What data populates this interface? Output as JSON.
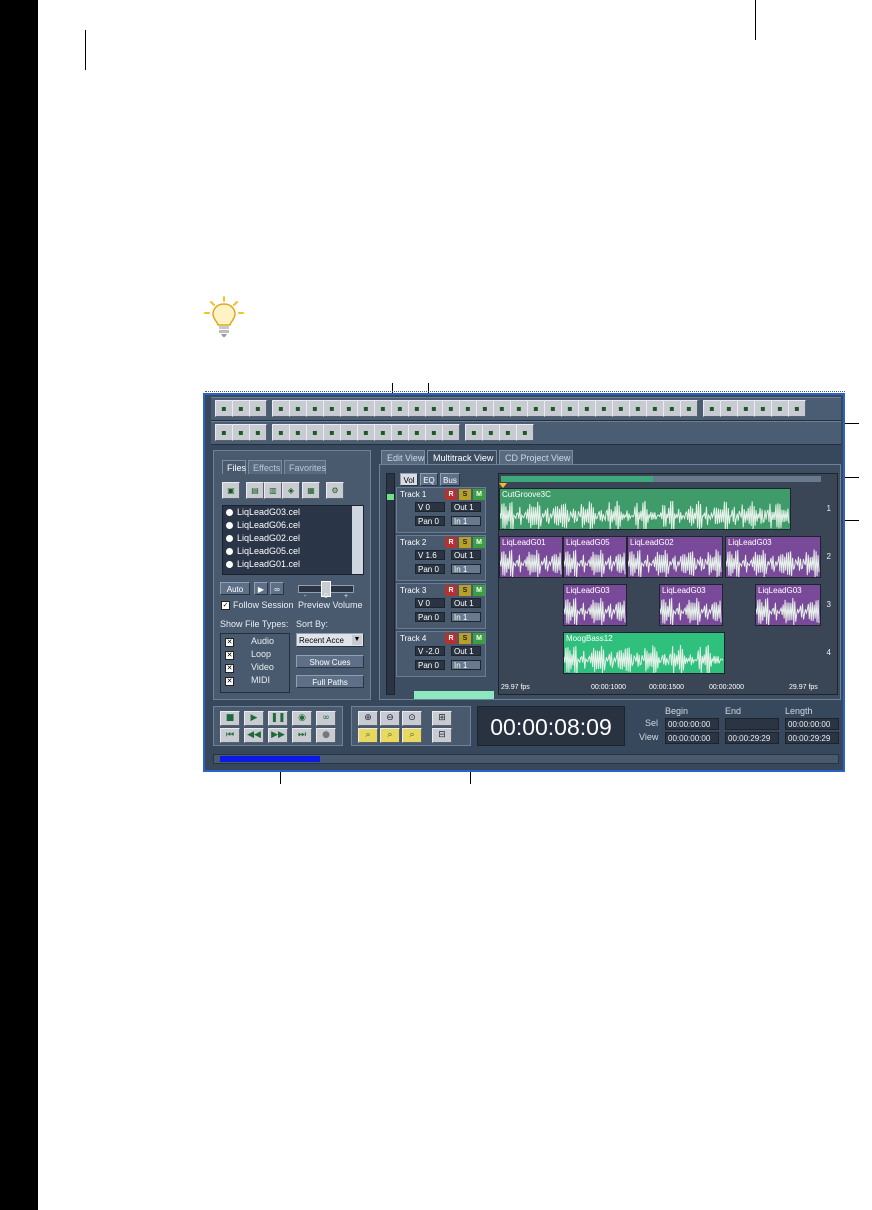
{
  "app": {
    "left_panel": {
      "tabs": [
        "Files",
        "Effects",
        "Favorites"
      ],
      "files": [
        "LiqLeadG03.cel",
        "LiqLeadG06.cel",
        "LiqLeadG02.cel",
        "LiqLeadG05.cel",
        "LiqLeadG01.cel"
      ],
      "auto_label": "Auto",
      "follow_session": "Follow Session",
      "preview_volume": "Preview Volume",
      "show_file_types": "Show File Types:",
      "file_types": [
        "Audio",
        "Loop",
        "Video",
        "MIDI"
      ],
      "sort_by": "Sort By:",
      "sort_value": "Recent Acce",
      "show_cues": "Show Cues",
      "full_paths": "Full Paths",
      "slider_marks": [
        "-",
        "0",
        "+"
      ]
    },
    "view_tabs": [
      "Edit View",
      "Multitrack View",
      "CD Project View"
    ],
    "mixer_tabs": [
      "Vol",
      "EQ",
      "Bus"
    ],
    "tracks": [
      {
        "name": "Track 1",
        "vol": "V 0",
        "out": "Out 1",
        "pan": "Pan 0",
        "in": "In 1"
      },
      {
        "name": "Track 2",
        "vol": "V 1.6",
        "out": "Out 1",
        "pan": "Pan 0",
        "in": "In 1"
      },
      {
        "name": "Track 3",
        "vol": "V 0",
        "out": "Out 1",
        "pan": "Pan 0",
        "in": "In 1"
      },
      {
        "name": "Track 4",
        "vol": "V -2.0",
        "out": "Out 1",
        "pan": "Pan 0",
        "in": "In 1"
      }
    ],
    "rsm": [
      "R",
      "S",
      "M"
    ],
    "clips": {
      "lane1": [
        "CutGroove3C"
      ],
      "lane2": [
        "LiqLeadG01",
        "LiqLeadG05",
        "LiqLeadG02",
        "LiqLeadG03"
      ],
      "lane3": [
        "LiqLeadG03",
        "LiqLeadG03",
        "LiqLeadG03"
      ],
      "lane4": [
        "MoogBass12"
      ]
    },
    "lane_numbers": [
      "1",
      "2",
      "3",
      "4"
    ],
    "ruler": [
      "29.97 fps",
      "00:00:1000",
      "00:00:1500",
      "00:00:2000",
      "29.97 fps"
    ],
    "time_display": "00:00:08:09",
    "sel_view": {
      "headers": [
        "Begin",
        "End",
        "Length"
      ],
      "rows": [
        {
          "label": "Sel",
          "values": [
            "00:00:00:00",
            "",
            "00:00:00:00"
          ]
        },
        {
          "label": "View",
          "values": [
            "00:00:00:00",
            "00:00:29:29",
            "00:00:29:29"
          ]
        }
      ]
    },
    "progress_fraction": 0.16
  },
  "colors": {
    "window_bg": "#38485c",
    "frame_blue": "#2c62c8",
    "green_clip": "#3f9b6a",
    "purple_clip": "#7a4a9a",
    "teal_clip": "#2fc07e",
    "progress": "#0a18e8"
  },
  "icons": [
    "lightbulb-icon",
    "play-icon",
    "stop-icon",
    "pause-icon",
    "record-icon",
    "loop-icon",
    "zoom-in-icon",
    "zoom-out-icon"
  ]
}
